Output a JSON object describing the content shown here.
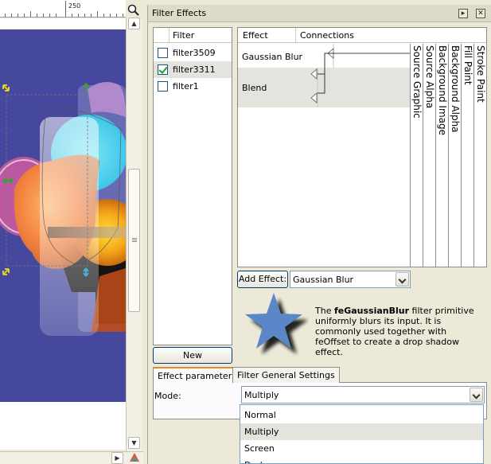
{
  "ruler": {
    "label": "250"
  },
  "dialog": {
    "title": "Filter Effects",
    "filter_list": {
      "header": "Filter",
      "items": [
        {
          "label": "filter3509",
          "checked": false
        },
        {
          "label": "filter3311",
          "checked": true
        },
        {
          "label": "filter1",
          "checked": false
        }
      ],
      "new_button": "New"
    },
    "effects": {
      "header_effect": "Effect",
      "header_connections": "Connections",
      "rows": [
        {
          "name": "Gaussian Blur"
        },
        {
          "name": "Blend"
        }
      ],
      "inputs": [
        "Source Graphic",
        "Source Alpha",
        "Background Image",
        "Background Alpha",
        "Fill Paint",
        "Stroke Paint"
      ]
    },
    "add_effect": {
      "button": "Add Effect:",
      "selected": "Gaussian Blur"
    },
    "description": {
      "prefix": "The ",
      "name": "feGaussianBlur",
      "text": " filter primitive uniformly blurs its input.  It is commonly used together with feOffset to create a drop shadow effect."
    },
    "tabs": [
      {
        "label": "Effect parameters",
        "active": true
      },
      {
        "label": "Filter General Settings",
        "active": false
      }
    ],
    "mode": {
      "label": "Mode:",
      "selected": "Multiply",
      "options": [
        "Normal",
        "Multiply",
        "Screen",
        "Darken"
      ]
    }
  },
  "colors": {
    "artwork_background": "#46489e",
    "star": "#5b87c8",
    "tab_accent": "#e68b2c"
  }
}
